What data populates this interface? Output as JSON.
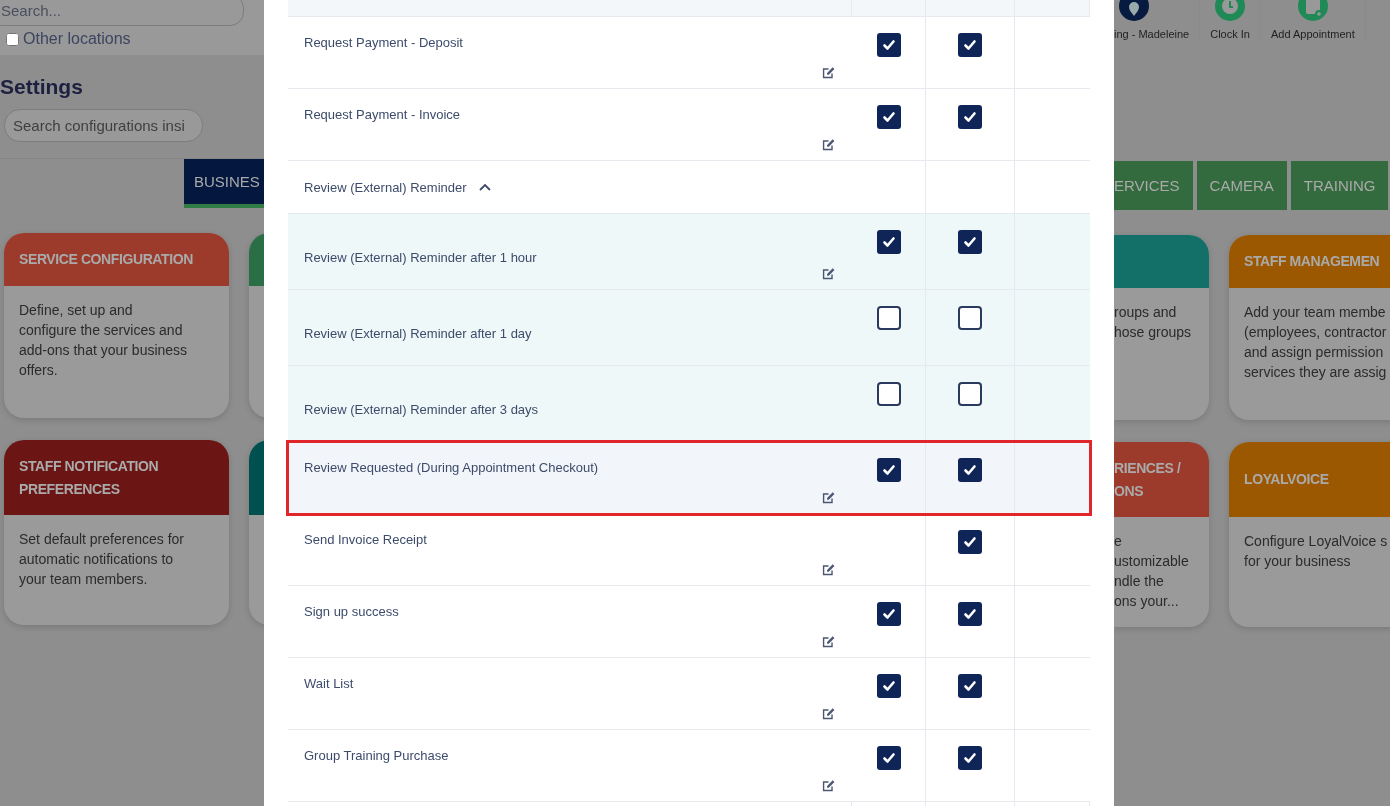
{
  "left_panel": {
    "location_search": {
      "placeholder": "Search..."
    },
    "other_locations": {
      "label": "Other locations",
      "checked": false
    },
    "title": "Settings",
    "config_search": {
      "placeholder": "Search configurations insi"
    },
    "tabs": [
      {
        "label": "BUSINES",
        "selected": true
      }
    ],
    "cards": [
      {
        "title": "SERVICE CONFIGURATION",
        "color": "#9c3b2b",
        "description": "Define, set up and configure the services and add-ons that your business offers."
      },
      {
        "color": "#2a6e45"
      },
      {
        "title": "STAFF NOTIFICATION PREFERENCES",
        "color": "#6b1515",
        "description": "Set default preferences for automatic notifications to your team members."
      },
      {
        "color": "#00504f"
      }
    ]
  },
  "notifications_table": {
    "rows": [
      {
        "name": "Request Payment - Deposit",
        "editable": true,
        "checkbox_1": true,
        "checkbox_2": true,
        "highlighted": false
      },
      {
        "name": "Request Payment - Invoice",
        "editable": true,
        "checkbox_1": true,
        "checkbox_2": true,
        "highlighted": false
      },
      {
        "name": "Review (External) Reminder",
        "expanded": true,
        "children": [
          {
            "name": "Review (External) Reminder after 1 hour",
            "editable": true,
            "checkbox_1": true,
            "checkbox_2": true
          },
          {
            "name": "Review (External) Reminder after 1 day",
            "editable": false,
            "checkbox_1": false,
            "checkbox_2": false
          },
          {
            "name": "Review (External) Reminder after 3 days",
            "editable": false,
            "checkbox_1": false,
            "checkbox_2": false
          }
        ]
      },
      {
        "name": "Review Requested (During Appointment Checkout)",
        "editable": true,
        "checkbox_1": true,
        "checkbox_2": true,
        "highlighted": true
      },
      {
        "name": "Send Invoice Receipt",
        "editable": true,
        "checkbox_2": true,
        "highlighted": false
      },
      {
        "name": "Sign up success",
        "editable": true,
        "checkbox_1": true,
        "checkbox_2": true,
        "highlighted": false
      },
      {
        "name": "Wait List",
        "editable": true,
        "checkbox_1": true,
        "checkbox_2": true,
        "highlighted": false
      },
      {
        "name": "Group Training Purchase",
        "editable": true,
        "checkbox_1": true,
        "checkbox_2": true,
        "highlighted": false
      }
    ]
  },
  "right_panel": {
    "toolbar": [
      {
        "label": "ing - Madeleine",
        "kind": "location"
      },
      {
        "label": "Clock In",
        "kind": "clock"
      },
      {
        "label": "Add Appointment",
        "kind": "calendar"
      }
    ],
    "tabs": [
      {
        "label": "ERVICES",
        "selected": false
      },
      {
        "label": "CAMERA",
        "selected": false
      },
      {
        "label": "TRAINING",
        "selected": false
      }
    ],
    "cards": [
      {
        "color": "#137068",
        "description": "roups and\nhose groups"
      },
      {
        "title": "STAFF MANAGEMEN",
        "color": "#9c5800",
        "description": "Add your team membe\n(employees, contractor\nand assign permission\nservices they are assig"
      },
      {
        "title": "RIENCES /\nONS",
        "color": "#9c3b2b",
        "description": "e\nustomizable\nndle the\nons your..."
      },
      {
        "title": "LOYALVOICE",
        "color": "#9c5800",
        "description": "Configure LoyalVoice s\nfor your business"
      }
    ]
  }
}
